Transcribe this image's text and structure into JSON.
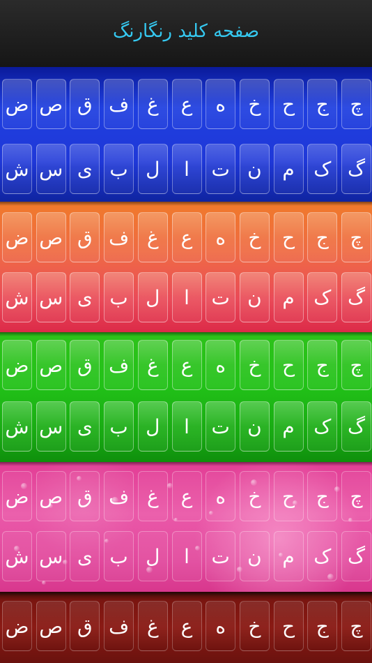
{
  "header": {
    "title": "صفحه کلید رنگارنگ"
  },
  "rows": {
    "top": [
      "چ",
      "ج",
      "ح",
      "خ",
      "ه",
      "ع",
      "غ",
      "ف",
      "ق",
      "ص",
      "ض"
    ],
    "bottom": [
      "گ",
      "ک",
      "م",
      "ن",
      "ت",
      "ا",
      "ل",
      "ب",
      "ی",
      "س",
      "ش"
    ]
  },
  "themes": [
    {
      "id": "blue",
      "name": "blue-theme",
      "color": "#1f38d8"
    },
    {
      "id": "orange",
      "name": "orange-theme",
      "color": "#ef6a45"
    },
    {
      "id": "green",
      "name": "green-theme",
      "color": "#22c218"
    },
    {
      "id": "pink",
      "name": "pink-theme",
      "color": "#ea58a8"
    },
    {
      "id": "darkred",
      "name": "dark-red-theme",
      "color": "#8a1a14"
    }
  ]
}
